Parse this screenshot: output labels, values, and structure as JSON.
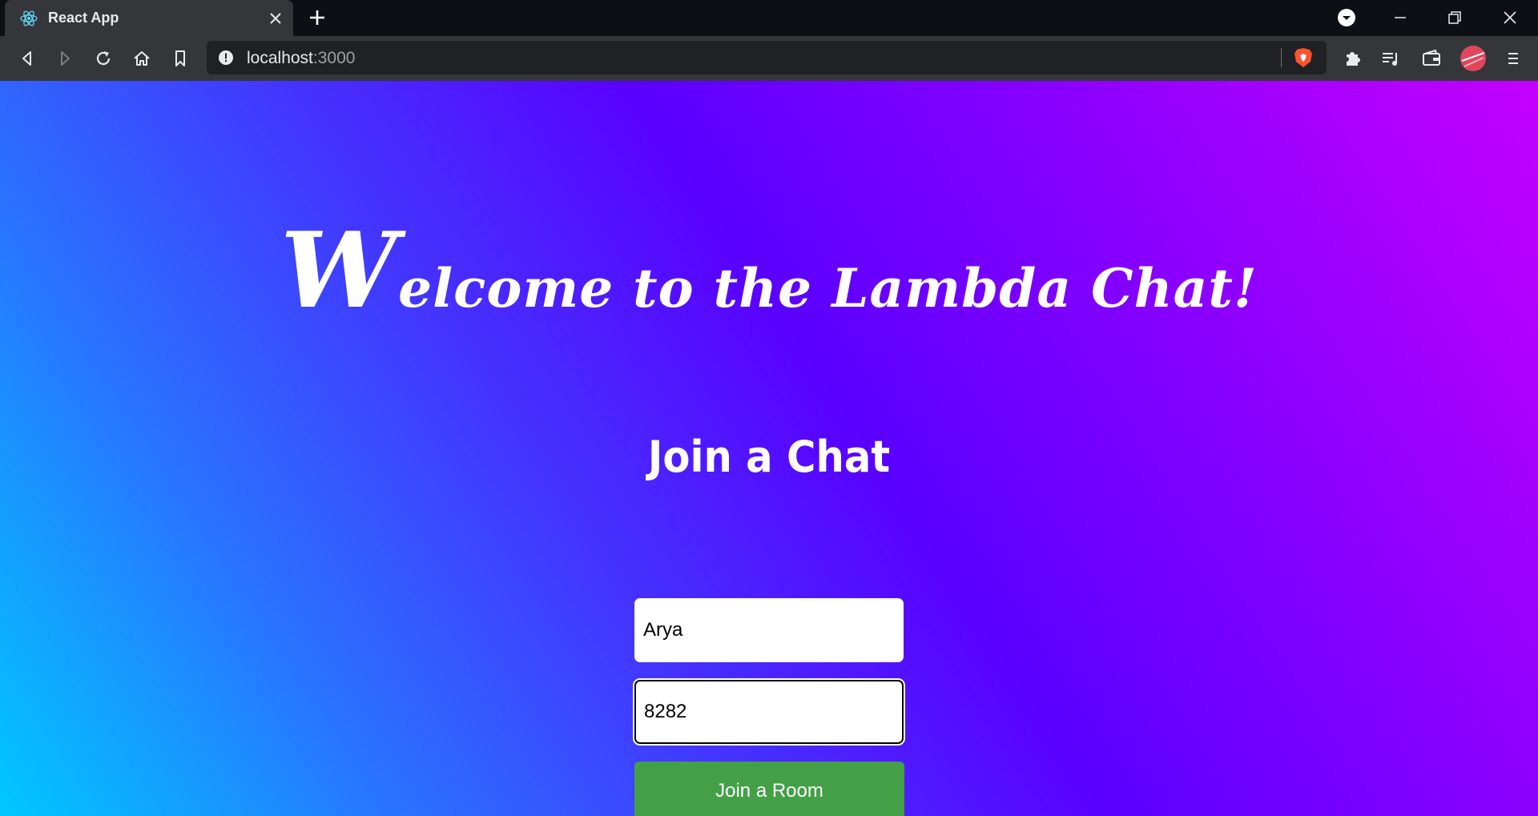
{
  "tab": {
    "title": "React App",
    "favicon": "react-logo-icon"
  },
  "toolbar": {
    "url_host": "localhost",
    "url_port": ":3000"
  },
  "page": {
    "welcome_cap": "W",
    "welcome_rest": "elcome to the Lambda Chat!",
    "join_heading": "Join a Chat",
    "name_value": "Arya",
    "room_value": "8282",
    "join_button": "Join a Room"
  },
  "colors": {
    "gradient_start": "#00c8ff",
    "gradient_mid": "#5a00ff",
    "gradient_end": "#c400ff",
    "button": "#43a047"
  }
}
